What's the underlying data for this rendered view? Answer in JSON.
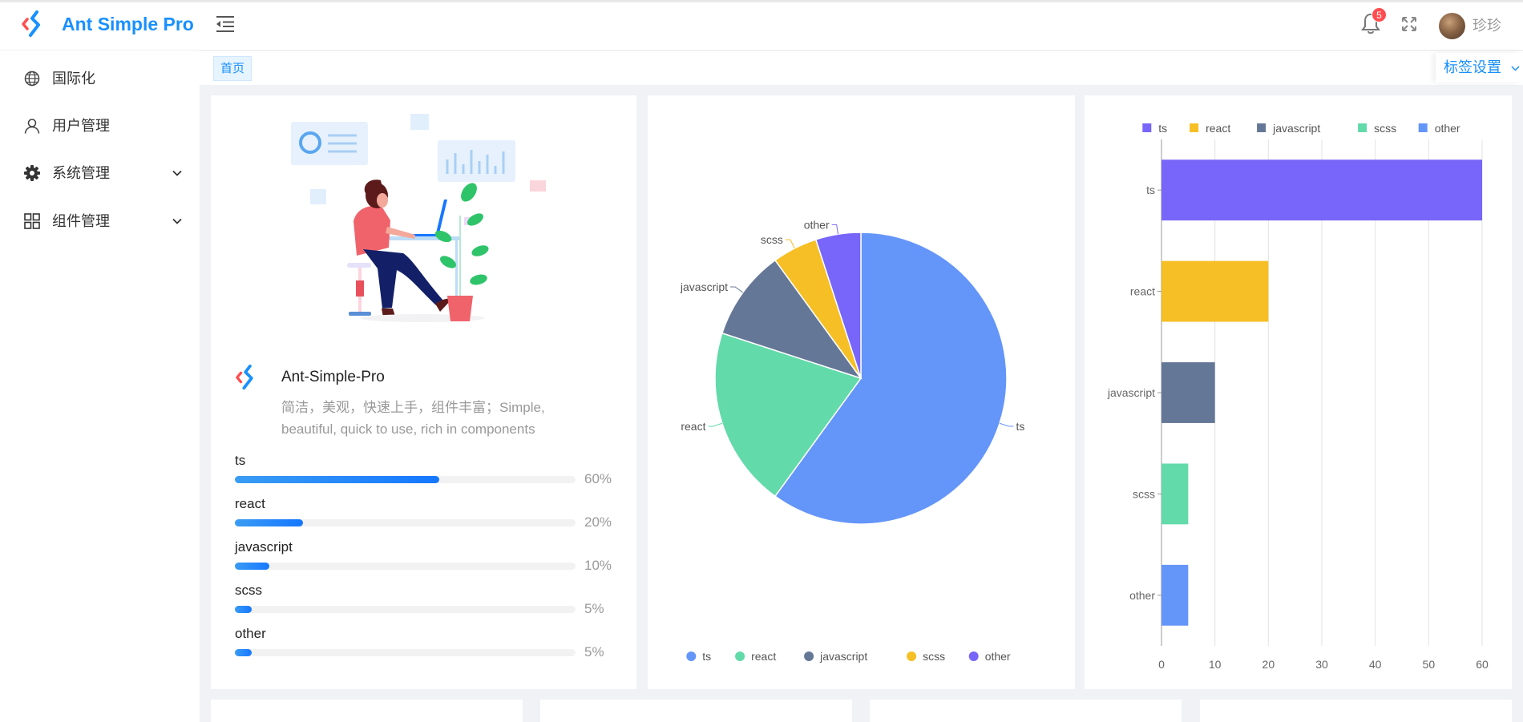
{
  "header": {
    "app_title": "Ant Simple Pro",
    "notification_count": "5",
    "username": "珍珍"
  },
  "sidebar": {
    "items": [
      {
        "label": "国际化",
        "icon": "globe-icon",
        "expandable": false
      },
      {
        "label": "用户管理",
        "icon": "user-icon",
        "expandable": false
      },
      {
        "label": "系统管理",
        "icon": "gear-icon",
        "expandable": true
      },
      {
        "label": "组件管理",
        "icon": "grid-icon",
        "expandable": true
      }
    ]
  },
  "tags": {
    "home": "首页",
    "settings": "标签设置"
  },
  "project": {
    "title": "Ant-Simple-Pro",
    "description": "简洁，美观，快速上手，组件丰富；Simple, beautiful, quick to use, rich in components",
    "progress": [
      {
        "label": "ts",
        "percent": 60,
        "percent_text": "60%"
      },
      {
        "label": "react",
        "percent": 20,
        "percent_text": "20%"
      },
      {
        "label": "javascript",
        "percent": 10,
        "percent_text": "10%"
      },
      {
        "label": "scss",
        "percent": 5,
        "percent_text": "5%"
      },
      {
        "label": "other",
        "percent": 5,
        "percent_text": "5%"
      }
    ]
  },
  "colors": {
    "primary": "#1890ff",
    "ts_pie": "#6495f9",
    "react": "#62daaa",
    "javascript": "#657797",
    "scss": "#f5bf25",
    "other_pie": "#7766f9"
  },
  "chart_data": [
    {
      "type": "pie",
      "categories": [
        "ts",
        "react",
        "javascript",
        "scss",
        "other"
      ],
      "values": [
        60,
        20,
        10,
        5,
        5
      ],
      "colors": [
        "#6495f9",
        "#62daaa",
        "#657797",
        "#f5bf25",
        "#7766f9"
      ],
      "legend": "bottom"
    },
    {
      "type": "bar",
      "orientation": "horizontal",
      "categories": [
        "ts",
        "react",
        "javascript",
        "scss",
        "other"
      ],
      "values": [
        60,
        20,
        10,
        5,
        5
      ],
      "colors": [
        "#7766f9",
        "#f5bf25",
        "#657797",
        "#62daaa",
        "#6495f9"
      ],
      "xlim": [
        0,
        60
      ],
      "xticks": [
        "0",
        "10",
        "20",
        "30",
        "40",
        "50",
        "60"
      ],
      "grid": true,
      "legend": "top"
    }
  ]
}
